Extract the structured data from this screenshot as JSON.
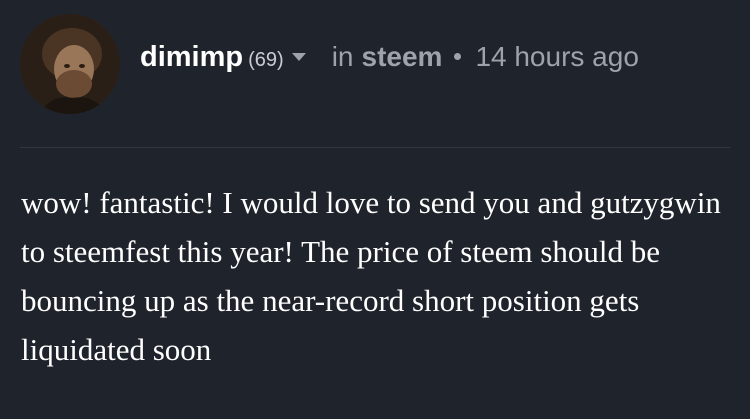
{
  "comment": {
    "author": "dimimp",
    "reputation": "(69)",
    "in_label": "in",
    "category": "steem",
    "timestamp": "14 hours ago",
    "avatar_icon": "avatar-portrait-icon",
    "body": "wow! fantastic! I would love to send you and gutzygwin to steemfest this year! The price of steem should be bouncing up as the near-record short position gets liquidated soon"
  },
  "colors": {
    "background": "#1f232b",
    "author": "#ffffff",
    "muted": "#9da2ab",
    "body_text": "#ffffff",
    "divider": "#32363f"
  }
}
